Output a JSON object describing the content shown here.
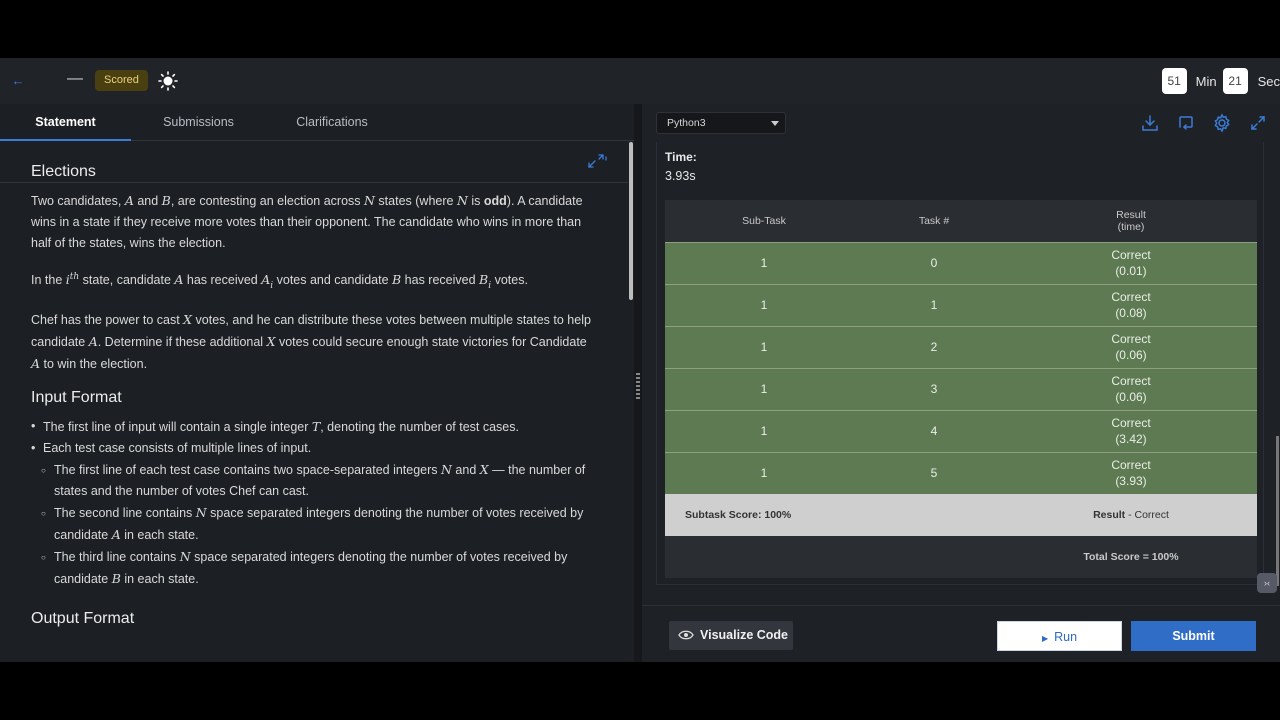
{
  "topbar": {
    "scored_badge": "Scored",
    "dash": "—",
    "timer": {
      "minutes": "51",
      "min_label": "Min",
      "seconds": "21",
      "sec_label": "Sec"
    }
  },
  "tabs": [
    {
      "label": "Statement",
      "active": true
    },
    {
      "label": "Submissions",
      "active": false
    },
    {
      "label": "Clarifications",
      "active": false
    }
  ],
  "problem": {
    "title": "Elections",
    "para1": {
      "t1": "Two candidates, ",
      "a": "A",
      "t2": " and ",
      "b": "B",
      "t3": ", are contesting an election across ",
      "n": "N",
      "t4": " states (where ",
      "n2": "N",
      "t5": " is ",
      "odd": "odd",
      "t6": "). A candidate wins in a state if they receive more votes than their opponent. The candidate who wins in more than half of the states, wins the election."
    },
    "para2": {
      "t1": "In the ",
      "i": "i",
      "th": "th",
      "t2": " state, candidate ",
      "a": "A",
      "t3": " has received ",
      "ai": "A",
      "sub": "i",
      "t4": " votes and candidate ",
      "b": "B",
      "t5": " has received ",
      "bi": "B",
      "sub2": "i",
      "t6": " votes."
    },
    "para3": {
      "t1": "Chef has the power to cast ",
      "x": "X",
      "t2": " votes, and he can distribute these votes between multiple states to help candidate ",
      "a": "A",
      "t3": ". Determine if these additional ",
      "x2": "X",
      "t4": " votes could secure enough state victories for Candidate ",
      "a2": "A",
      "t5": " to win the election."
    },
    "input_title": "Input Format",
    "input_items": {
      "i1": {
        "t1": "The first line of input will contain a single integer ",
        "m": "T",
        "t2": ", denoting the number of test cases."
      },
      "i2": {
        "t1": "Each test case consists of multiple lines of input."
      },
      "s1": {
        "t1": "The first line of each test case contains two space-separated integers ",
        "m": "N",
        "t2": " and ",
        "m2": "X",
        "t3": " — the number of states and the number of votes Chef can cast."
      },
      "s2": {
        "t1": "The second line contains ",
        "m": "N",
        "t2": " space separated integers denoting the number of votes received by candidate ",
        "m2": "A",
        "t3": " in each state."
      },
      "s3": {
        "t1": "The third line contains ",
        "m": "N",
        "t2": " space separated integers denoting the number of votes received by candidate ",
        "m2": "B",
        "t3": " in each state."
      }
    },
    "output_title": "Output Format"
  },
  "editor": {
    "language": "Python3",
    "time_label": "Time:",
    "time_value": "3.93s",
    "table_headers": {
      "subtask": "Sub-Task",
      "task": "Task #",
      "result_line1": "Result",
      "result_line2": "(time)"
    },
    "rows": [
      {
        "subtask": "1",
        "task": "0",
        "result": "Correct",
        "time": "(0.01)"
      },
      {
        "subtask": "1",
        "task": "1",
        "result": "Correct",
        "time": "(0.08)"
      },
      {
        "subtask": "1",
        "task": "2",
        "result": "Correct",
        "time": "(0.06)"
      },
      {
        "subtask": "1",
        "task": "3",
        "result": "Correct",
        "time": "(0.06)"
      },
      {
        "subtask": "1",
        "task": "4",
        "result": "Correct",
        "time": "(3.42)"
      },
      {
        "subtask": "1",
        "task": "5",
        "result": "Correct",
        "time": "(3.93)"
      }
    ],
    "subtask_score": "Subtask Score: 100%",
    "result_label": "Result",
    "result_sep": " - ",
    "result_value": "Correct",
    "total_score": "Total Score = 100%",
    "side_tag": "›‹"
  },
  "buttons": {
    "visualize": "Visualize Code",
    "run": "Run",
    "submit": "Submit"
  },
  "colors": {
    "accent": "#3b7cd8",
    "correct_row": "#5e7a53",
    "submit": "#2f6dc7"
  }
}
